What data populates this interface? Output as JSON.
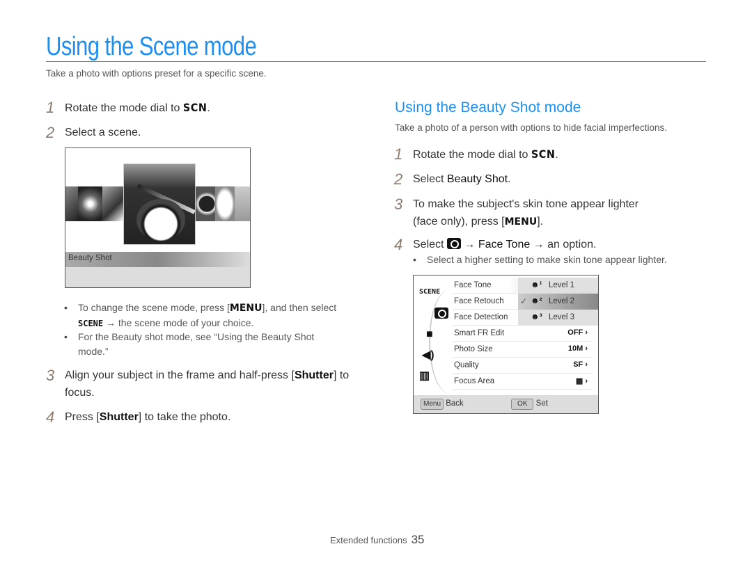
{
  "page": {
    "title": "Using the Scene mode",
    "subtitle": "Take a photo with options preset for a specific scene."
  },
  "left": {
    "steps": [
      {
        "num": "1",
        "text": "Rotate the mode dial to ",
        "key": "SCN",
        "after": "."
      },
      {
        "num": "2",
        "text": "Select a scene."
      },
      {
        "num": "3",
        "text_before": "Align your subject in the frame and half-press [",
        "key": "Shutter",
        "text_after": "] to focus."
      },
      {
        "num": "4",
        "text_before": "Press [",
        "key": "Shutter",
        "text_after": "] to take the photo."
      }
    ],
    "scene_screen": {
      "selected_label": "Beauty Shot"
    },
    "bullets": [
      {
        "before": "To change the scene mode, press [",
        "key": "MENU",
        "after": "], and then select ",
        "scene": "SCENE",
        "arrow": " → the scene mode of your choice."
      },
      {
        "text": "For the Beauty shot mode, see “Using the Beauty Shot mode.”"
      }
    ]
  },
  "right": {
    "title": "Using the Beauty Shot mode",
    "subtitle": "Take a photo of a person with options to hide facial imperfections.",
    "steps": [
      {
        "num": "1",
        "text": "Rotate the mode dial to ",
        "key": "SCN",
        "after": "."
      },
      {
        "num": "2",
        "text": "Select ",
        "key": "Beauty Shot",
        "after": "."
      },
      {
        "num": "3",
        "text": "To make the subject's skin tone appear lighter (face only), press [",
        "key": "MENU",
        "after": "]."
      },
      {
        "num": "4",
        "text": "Select ",
        "arrow1": " → ",
        "key": "Face Tone",
        "arrow2": " → an option."
      }
    ],
    "bullet": "Select a higher setting to make skin tone appear lighter."
  },
  "menu_screen": {
    "side_icons": [
      "scene-icon",
      "camera-icon",
      "video-icon",
      "sound-icon",
      "display-icon"
    ],
    "side_scene_label": "SCENE",
    "items": [
      {
        "label": "Face Tone",
        "value": ""
      },
      {
        "label": "Face Retouch",
        "value": ""
      },
      {
        "label": "Face Detection",
        "value": ""
      },
      {
        "label": "Smart FR Edit",
        "value": "OFF ›"
      },
      {
        "label": "Photo Size",
        "value": "10M ›"
      },
      {
        "label": "Quality",
        "value": "SF ›"
      },
      {
        "label": "Focus Area",
        "value": "▦ ›"
      }
    ],
    "submenu": [
      {
        "label": "Level 1",
        "icon": "☻¹",
        "selected": false
      },
      {
        "label": "Level 2",
        "icon": "☻²",
        "selected": true
      },
      {
        "label": "Level 3",
        "icon": "☻³",
        "selected": false
      }
    ],
    "check": "✓",
    "footer": {
      "back_key": "Menu",
      "back_label": "Back",
      "set_key": "OK",
      "set_label": "Set"
    }
  },
  "footer": {
    "section": "Extended functions",
    "page": "35"
  }
}
